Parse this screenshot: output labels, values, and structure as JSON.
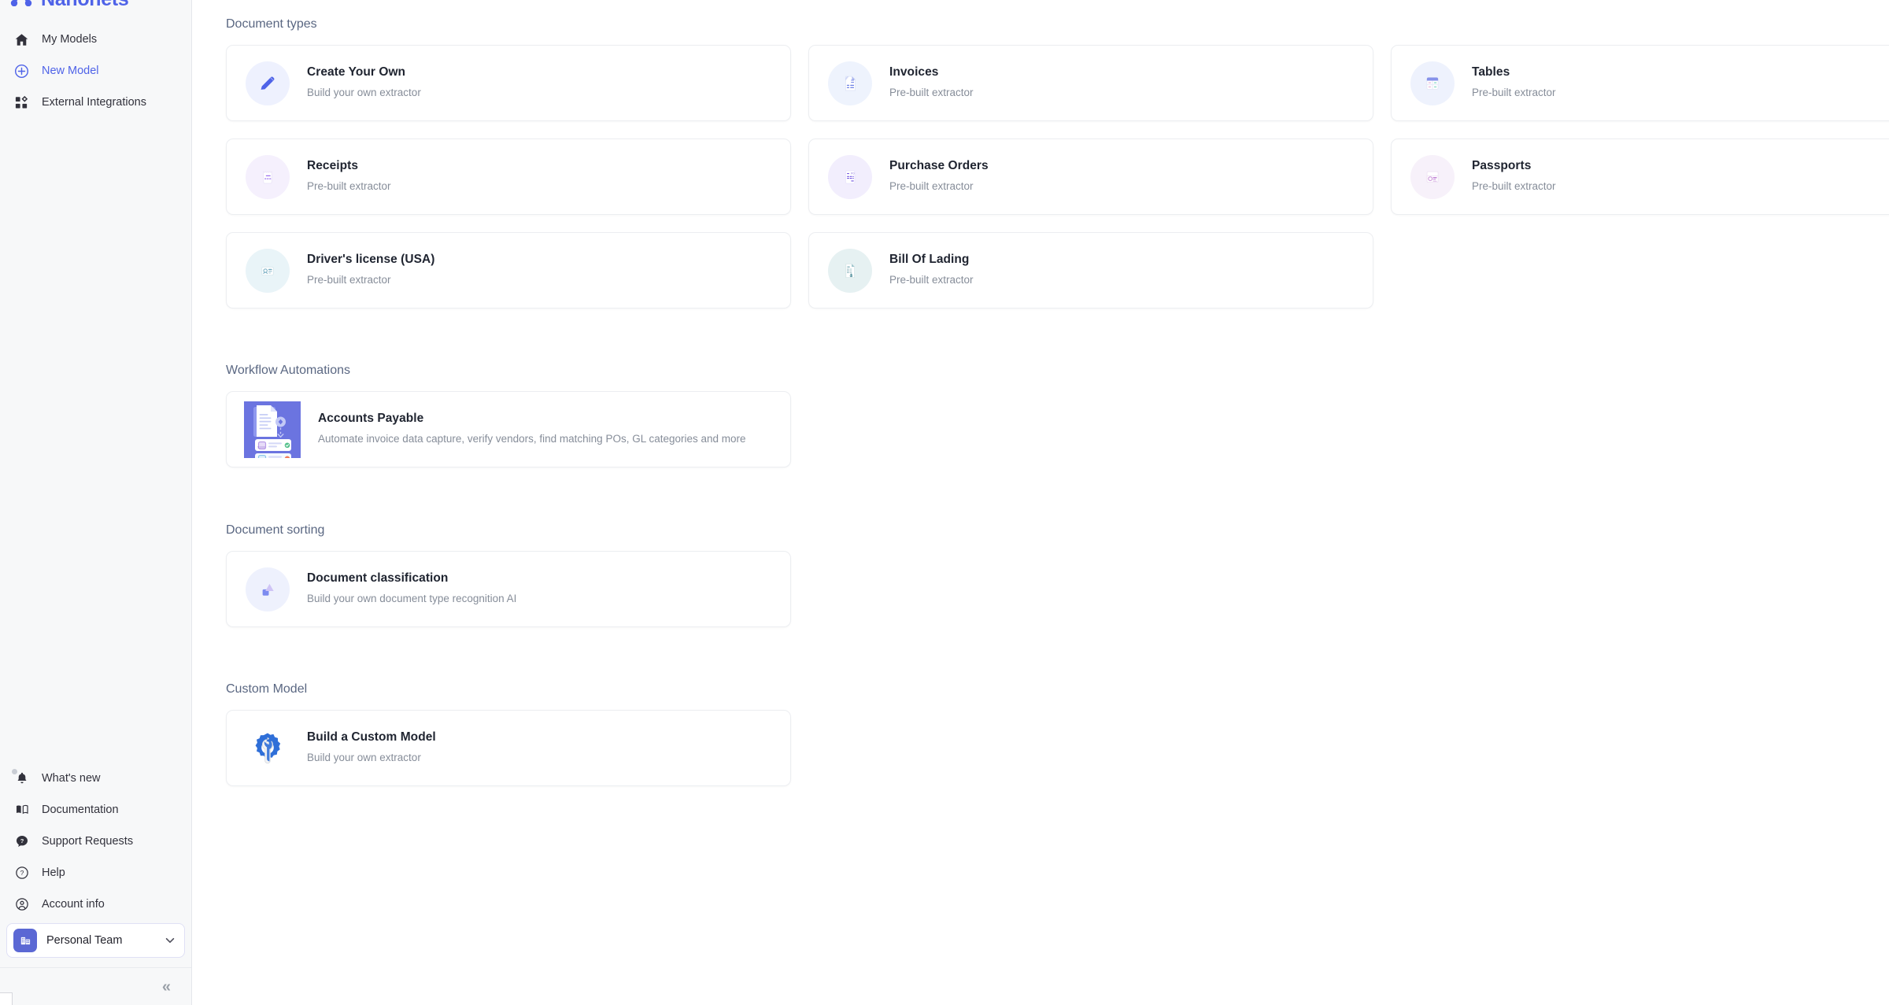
{
  "brand": {
    "name": "Nanonets",
    "color": "#4f63e8"
  },
  "sidebar": {
    "nav": [
      {
        "label": "My Models",
        "icon": "home-icon",
        "active": false
      },
      {
        "label": "New Model",
        "icon": "plus-circle-icon",
        "active": true
      },
      {
        "label": "External Integrations",
        "icon": "integrations-icon",
        "active": false
      }
    ],
    "bottom_nav": [
      {
        "label": "What's new",
        "icon": "bell-icon"
      },
      {
        "label": "Documentation",
        "icon": "book-icon"
      },
      {
        "label": "Support Requests",
        "icon": "support-icon"
      },
      {
        "label": "Help",
        "icon": "question-circle-icon"
      },
      {
        "label": "Account info",
        "icon": "user-circle-icon"
      }
    ],
    "team": {
      "label": "Personal Team",
      "icon": "building-icon",
      "chevron": "chevron-down-icon"
    },
    "collapse": {
      "label": "«",
      "icon": "collapse-sidebar-icon"
    }
  },
  "main": {
    "sections": [
      {
        "id": "document-types",
        "title": "Document types",
        "cards": [
          {
            "title": "Create Your Own",
            "subtitle": "Build your own extractor",
            "icon": "pencil-icon",
            "tint": "#eef1fe"
          },
          {
            "title": "Invoices",
            "subtitle": "Pre-built extractor",
            "icon": "invoice-doc-icon",
            "tint": "#eef3fd"
          },
          {
            "title": "Tables",
            "subtitle": "Pre-built extractor",
            "icon": "table-grid-icon",
            "tint": "#eef2fd"
          },
          {
            "title": "Receipts",
            "subtitle": "Pre-built extractor",
            "icon": "receipt-icon",
            "tint": "#f5f0fd"
          },
          {
            "title": "Purchase Orders",
            "subtitle": "Pre-built extractor",
            "icon": "purchase-order-icon",
            "tint": "#f2eefd"
          },
          {
            "title": "Passports",
            "subtitle": "Pre-built extractor",
            "icon": "passport-id-icon",
            "tint": "#f7f1fa"
          },
          {
            "title": "Driver's license (USA)",
            "subtitle": "Pre-built extractor",
            "icon": "drivers-license-icon",
            "tint": "#e9f4f8"
          },
          {
            "title": "Bill Of Lading",
            "subtitle": "Pre-built extractor",
            "icon": "bill-of-lading-icon",
            "tint": "#e6f1f2"
          }
        ]
      },
      {
        "id": "workflow-automations",
        "title": "Workflow Automations",
        "cards": [
          {
            "title": "Accounts Payable",
            "subtitle": "Automate invoice data capture, verify vendors, find matching POs, GL categories and more",
            "icon": "accounts-payable-icon",
            "tint": "#6b74e0"
          }
        ]
      },
      {
        "id": "document-sorting",
        "title": "Document sorting",
        "cards": [
          {
            "title": "Document classification",
            "subtitle": "Build your own document type recognition AI",
            "icon": "classification-icon",
            "tint": "#eef1fd"
          }
        ]
      },
      {
        "id": "custom-model",
        "title": "Custom Model",
        "cards": [
          {
            "title": "Build a Custom Model",
            "subtitle": "Build your own extractor",
            "icon": "gear-wrench-icon",
            "tint": "#ffffff"
          }
        ]
      }
    ]
  }
}
